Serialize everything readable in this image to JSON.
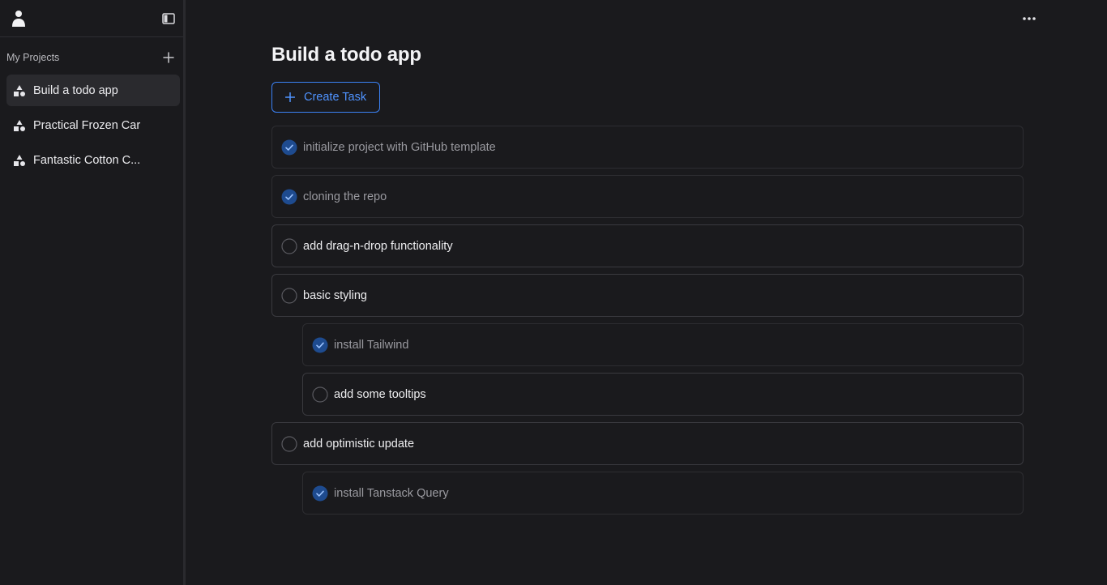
{
  "sidebar": {
    "section_title": "My Projects",
    "projects": [
      {
        "label": "Build a todo app",
        "active": true
      },
      {
        "label": "Practical Frozen Car",
        "active": false
      },
      {
        "label": "Fantastic Cotton C...",
        "active": false
      }
    ]
  },
  "main": {
    "title": "Build a todo app",
    "create_button_label": "Create Task",
    "tasks": [
      {
        "label": "initialize project with GitHub template",
        "done": true,
        "level": 0
      },
      {
        "label": "cloning the repo",
        "done": true,
        "level": 0
      },
      {
        "label": "add drag-n-drop functionality",
        "done": false,
        "level": 0
      },
      {
        "label": "basic styling",
        "done": false,
        "level": 0
      },
      {
        "label": "install Tailwind",
        "done": true,
        "level": 1
      },
      {
        "label": "add some tooltips",
        "done": false,
        "level": 1
      },
      {
        "label": "add optimistic update",
        "done": false,
        "level": 0
      },
      {
        "label": "install Tanstack Query",
        "done": true,
        "level": 1
      }
    ]
  },
  "colors": {
    "background": "#1a1a1d",
    "accent": "#3b82f6",
    "check_fill": "#1e4b8f"
  },
  "icons": [
    "avatar-icon",
    "sidebar-toggle-icon",
    "plus-icon",
    "project-shapes-icon",
    "more-horizontal-icon",
    "check-circle-icon",
    "empty-circle-icon"
  ]
}
